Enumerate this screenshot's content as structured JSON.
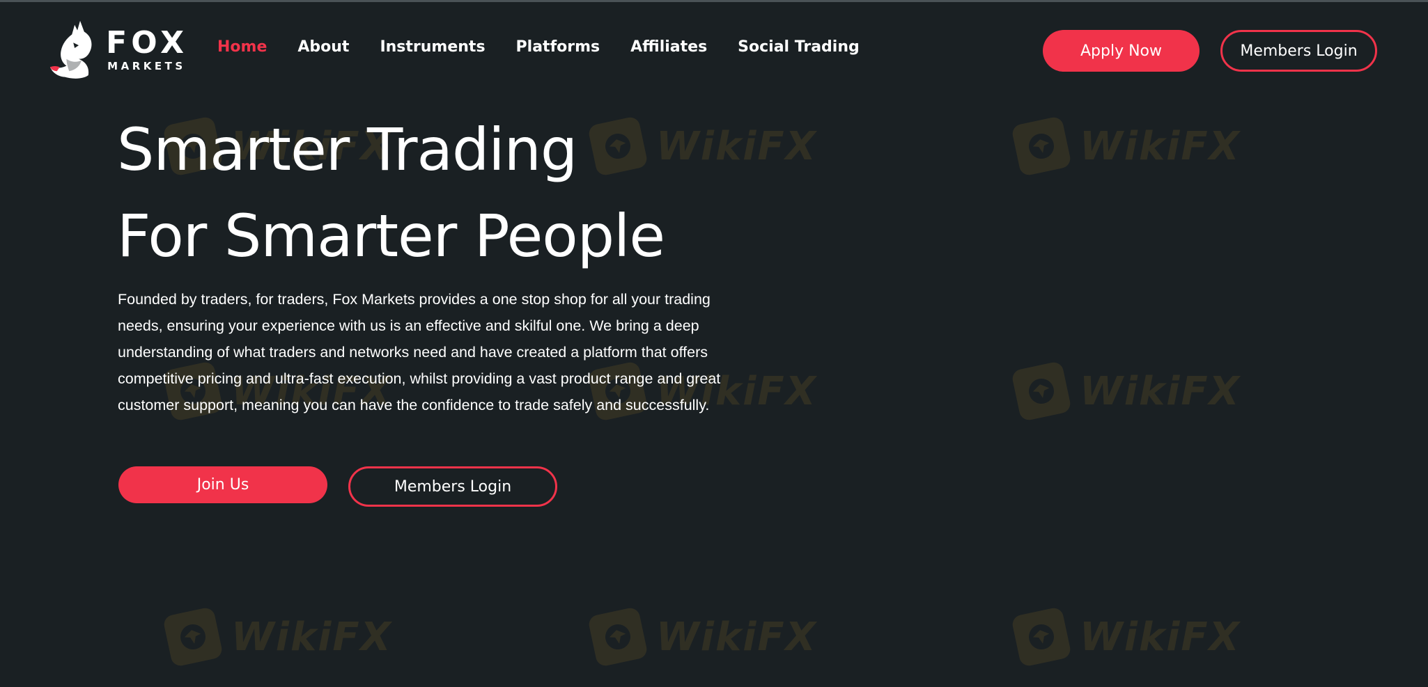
{
  "brand": {
    "logo_line1": "FOX",
    "logo_line2": "MARKETS",
    "accent_color": "#f1334a",
    "background_color": "#1a2023"
  },
  "nav": {
    "items": [
      {
        "label": "Home",
        "active": true
      },
      {
        "label": "About",
        "active": false
      },
      {
        "label": "Instruments",
        "active": false
      },
      {
        "label": "Platforms",
        "active": false
      },
      {
        "label": "Affiliates",
        "active": false
      },
      {
        "label": "Social Trading",
        "active": false
      }
    ]
  },
  "header_actions": {
    "apply_label": "Apply Now",
    "login_label": "Members Login"
  },
  "hero": {
    "title_line1": "Smarter Trading",
    "title_line2": "For Smarter People",
    "description": "Founded by traders, for traders, Fox Markets provides a one stop shop for all your trading needs, ensuring your experience with us is an effective and skilful one. We bring a deep understanding of what traders and networks need and have created a platform that offers competitive pricing and ultra-fast execution, whilst providing a vast product range and great customer support, meaning you can have the confidence to trade safely and successfully.",
    "join_label": "Join Us",
    "login_label": "Members Login"
  },
  "watermark": {
    "text": "WikiFX",
    "icon": "wikifx-eagle-icon"
  }
}
